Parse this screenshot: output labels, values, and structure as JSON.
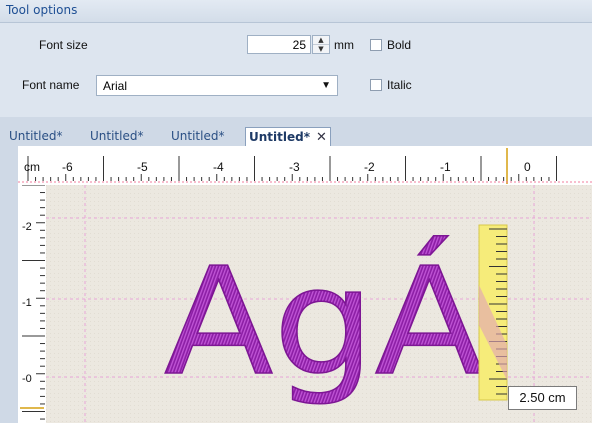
{
  "panel": {
    "title": "Tool options",
    "font_size_label": "Font size",
    "font_size_value": "25",
    "unit": "mm",
    "bold_label": "Bold",
    "font_name_label": "Font name",
    "font_name_value": "Arial",
    "italic_label": "Italic"
  },
  "tabs": [
    {
      "label": "Untitled*"
    },
    {
      "label": "Untitled*"
    },
    {
      "label": "Untitled*"
    },
    {
      "label": "Untitled*",
      "active": true
    }
  ],
  "ruler": {
    "unit_label": "cm",
    "h_labels": [
      "-6",
      "-5",
      "-4",
      "-3",
      "-2",
      "-1",
      "0"
    ],
    "v_labels": [
      "-2",
      "-1",
      "-0"
    ]
  },
  "canvas": {
    "text": "AgÁ",
    "thread_color": "#9a25b2"
  },
  "measure": {
    "readout": "2.50 cm"
  },
  "icons": {
    "tab_close": "close-icon",
    "dropdown": "chevron-down-icon",
    "spin_up": "spin-up-icon",
    "spin_down": "spin-down-icon"
  }
}
